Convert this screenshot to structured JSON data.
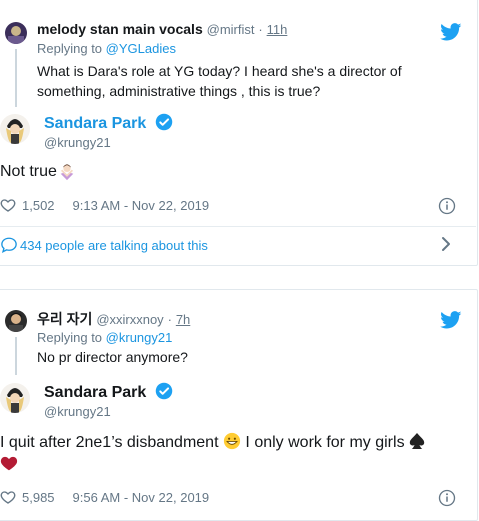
{
  "tweet1": {
    "author_name": "melody stan main vocals",
    "author_handle": "@mirfist",
    "time": "11h",
    "replying_prefix": "Replying to",
    "replying_to": "@YGLadies",
    "text_line1": "What is Dara's role at YG today? I heard she's a director of",
    "text_line2": "something, administrative things , this is true?"
  },
  "reply1": {
    "author_name": "Sandara Park",
    "author_handle": "@krungy21",
    "text": "Not true",
    "likes": "1,502",
    "timestamp": "9:13 AM - Nov 22, 2019",
    "talking": "434 people are talking about this"
  },
  "tweet2": {
    "author_name": "우리 자기",
    "author_handle": "@xxirxxnoy",
    "time": "7h",
    "replying_prefix": "Replying to",
    "replying_to": "@krungy21",
    "text": "No pr director anymore?"
  },
  "reply2": {
    "author_name": "Sandara Park",
    "author_handle": "@krungy21",
    "text_part1": "I quit after 2ne1’s disbandment",
    "text_part2": " I only work for my girls",
    "likes": "5,985",
    "timestamp": "9:56 AM - Nov 22, 2019"
  },
  "colors": {
    "twitter_blue": "#1da1f2",
    "link_blue": "#1b95e0",
    "muted_gray": "#657786",
    "border": "#e1e8ed"
  },
  "icons": [
    "twitter-bird-icon",
    "verified-badge-icon",
    "heart-icon",
    "info-icon",
    "comment-icon",
    "chevron-right-icon"
  ]
}
